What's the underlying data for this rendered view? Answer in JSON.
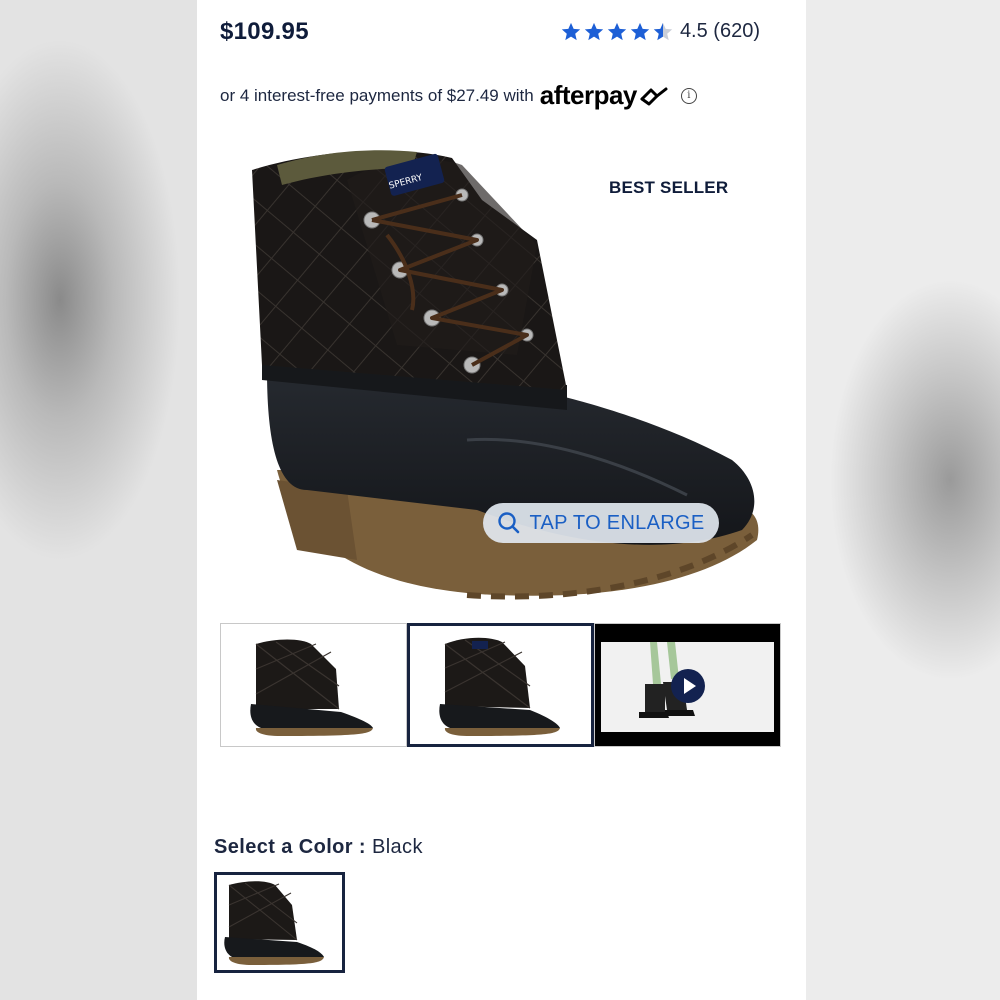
{
  "product": {
    "price": "$109.95",
    "rating_value": 4.5,
    "rating_text": "4.5 (620)",
    "best_seller_badge": "BEST SELLER",
    "enlarge_label": "TAP TO ENLARGE"
  },
  "afterpay": {
    "text": "or 4 interest-free payments of $27.49 with",
    "logo_text": "afterpay",
    "info_glyph": "i"
  },
  "thumbnails": [
    {
      "kind": "image",
      "selected": false,
      "icon": "boot-side-image"
    },
    {
      "kind": "image",
      "selected": true,
      "icon": "boot-angle-image"
    },
    {
      "kind": "video",
      "selected": false,
      "icon": "play-icon"
    }
  ],
  "color_selector": {
    "label_prefix": "Select a Color : ",
    "selected_color": "Black"
  },
  "colors": {
    "accent_blue": "#1a5fc4",
    "star_blue": "#1d5fd6",
    "navy": "#0f1c3a",
    "sole_brown": "#7a5f3b"
  }
}
